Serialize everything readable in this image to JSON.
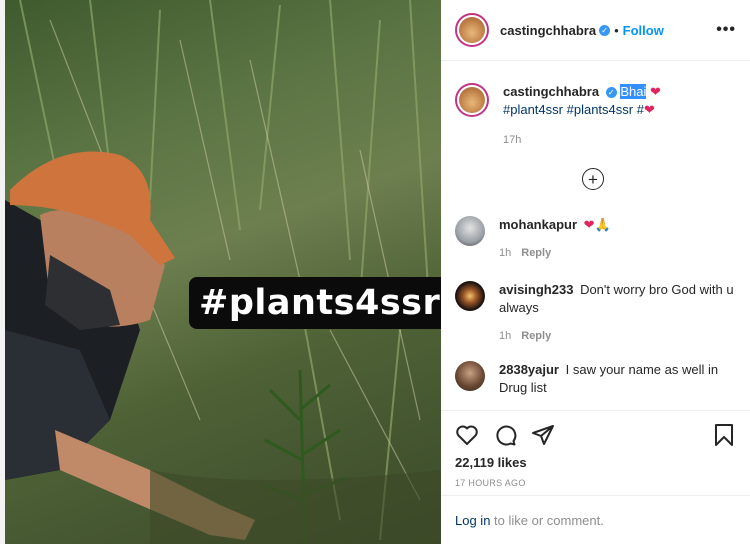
{
  "photo": {
    "sticker_text": "#plants4ssr"
  },
  "post": {
    "username": "castingchhabra",
    "follow_label": "Follow",
    "more_label": "•••",
    "caption": {
      "highlight": "Bhai",
      "heart": "❤",
      "tag1": "#plant4ssr",
      "tag2": "#plants4ssr",
      "tag3": "#"
    },
    "time": "17h",
    "likes": "22,119 likes",
    "posted_ago": "17 HOURS AGO",
    "login_link": "Log in",
    "login_rest": " to like or comment."
  },
  "comments": [
    {
      "user": "mohankapur",
      "text": "❤🙏",
      "time": "1h",
      "reply": "Reply"
    },
    {
      "user": "avisingh233",
      "text": "Don't worry bro God with u always",
      "time": "1h",
      "reply": "Reply"
    },
    {
      "user": "2838yajur",
      "text": "I saw your name as well in Drug list",
      "time": "",
      "reply": ""
    }
  ],
  "colors": {
    "accent": "#0095f6",
    "verified": "#3897f0",
    "highlight": "#3390ff",
    "heart": "#e0245e"
  },
  "icons": [
    "more-icon",
    "verified-icon",
    "load-more-icon",
    "heart-icon",
    "comment-icon",
    "share-icon",
    "save-icon"
  ]
}
